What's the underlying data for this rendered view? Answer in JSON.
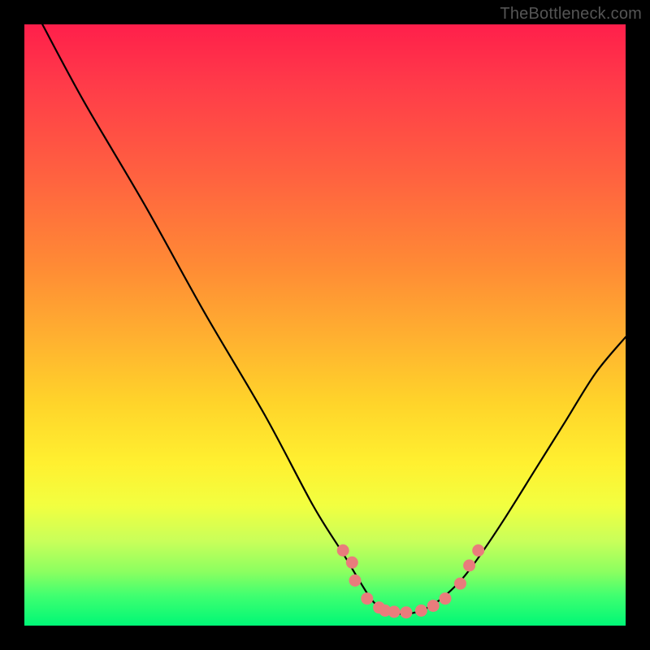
{
  "watermark": "TheBottleneck.com",
  "chart_data": {
    "type": "line",
    "title": "",
    "xlabel": "",
    "ylabel": "",
    "xlim": [
      0,
      100
    ],
    "ylim": [
      0,
      100
    ],
    "grid": false,
    "legend": false,
    "series": [
      {
        "name": "bottleneck-curve",
        "x": [
          3,
          10,
          20,
          30,
          40,
          48,
          53,
          56,
          58,
          60,
          62,
          64,
          66,
          68,
          70,
          73,
          76,
          80,
          85,
          90,
          95,
          100
        ],
        "y": [
          100,
          87,
          70,
          52,
          35,
          20,
          12,
          7,
          4,
          2.5,
          2,
          2,
          2.5,
          3.5,
          5,
          8,
          12,
          18,
          26,
          34,
          42,
          48
        ]
      }
    ],
    "markers": {
      "name": "highlight-dots",
      "color": "#e97c7c",
      "points": [
        {
          "x": 53,
          "y": 12.5
        },
        {
          "x": 54.5,
          "y": 10.5
        },
        {
          "x": 55,
          "y": 7.5
        },
        {
          "x": 57,
          "y": 4.5
        },
        {
          "x": 59,
          "y": 3
        },
        {
          "x": 60,
          "y": 2.5
        },
        {
          "x": 61.5,
          "y": 2.3
        },
        {
          "x": 63.5,
          "y": 2.2
        },
        {
          "x": 66,
          "y": 2.5
        },
        {
          "x": 68,
          "y": 3.3
        },
        {
          "x": 70,
          "y": 4.5
        },
        {
          "x": 72.5,
          "y": 7
        },
        {
          "x": 74,
          "y": 10
        },
        {
          "x": 75.5,
          "y": 12.5
        }
      ]
    }
  }
}
